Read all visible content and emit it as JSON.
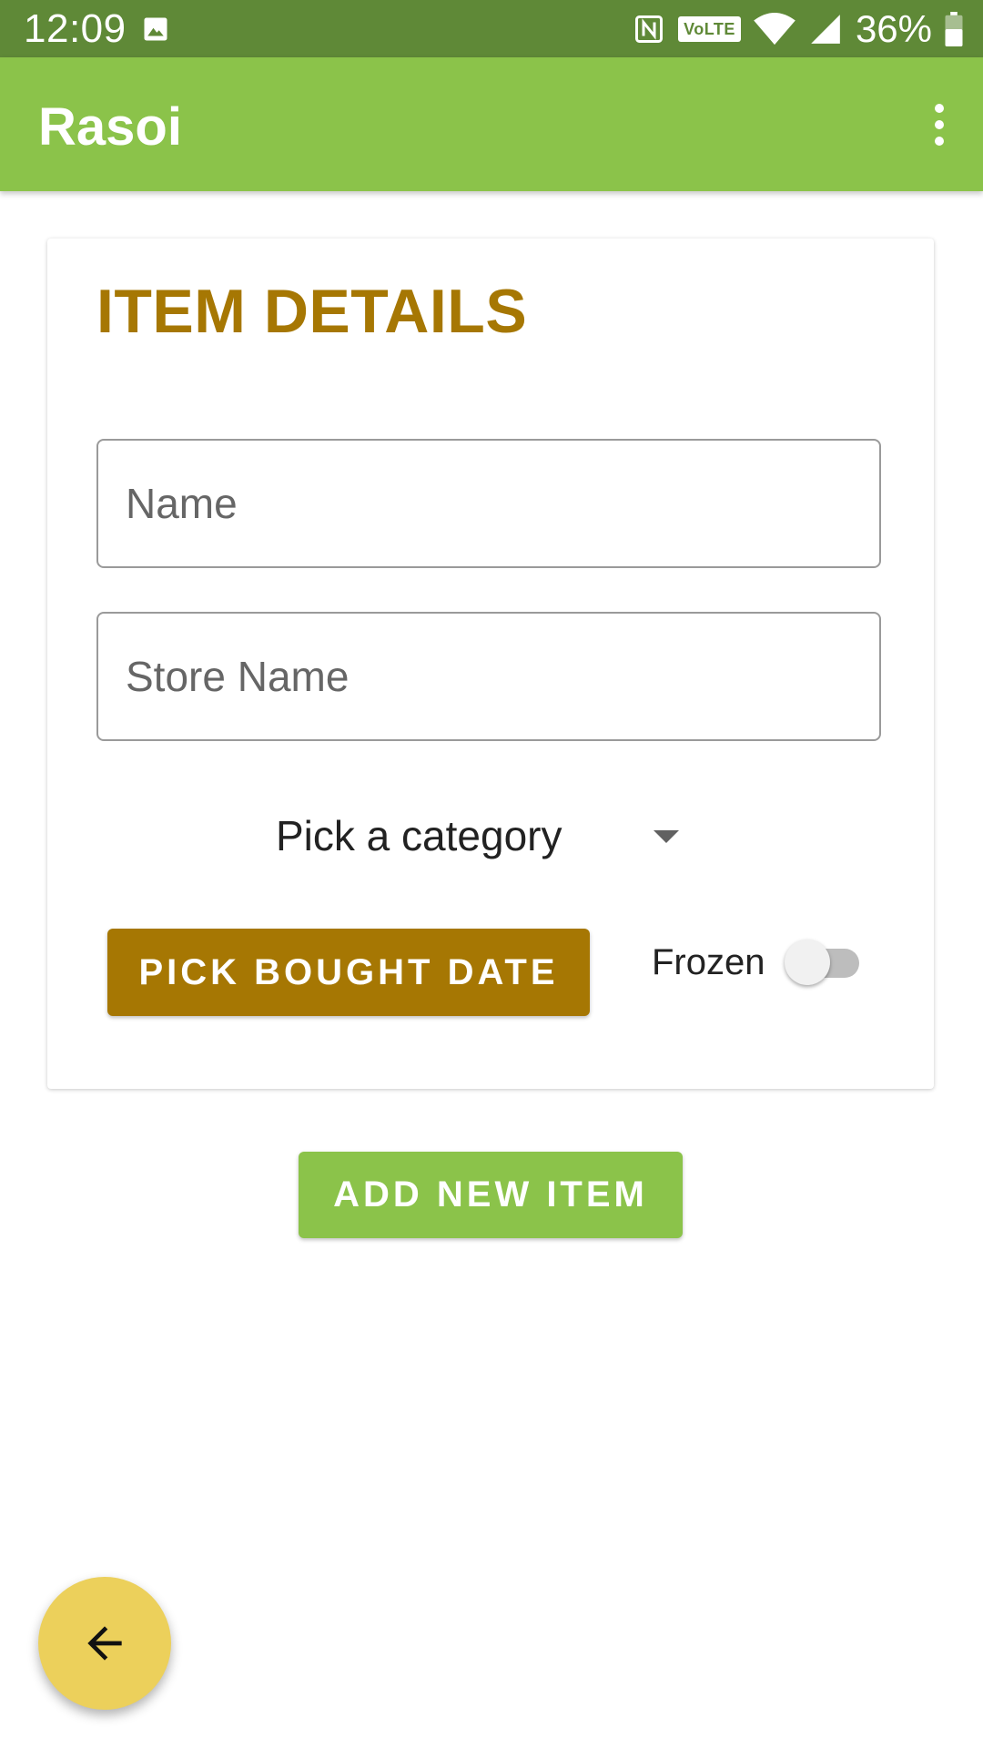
{
  "status_bar": {
    "time": "12:09",
    "left_icons": [
      "image-icon"
    ],
    "right_icons": [
      "nfc-icon",
      "volte-icon",
      "wifi-icon",
      "signal-icon",
      "battery-icon"
    ],
    "volte_label": "VoLTE",
    "battery_percent": "36%",
    "background_color": "#5f8937"
  },
  "app_bar": {
    "title": "Rasoi",
    "menu_icon": "overflow-menu-icon",
    "background_color": "#8bc34a"
  },
  "card": {
    "title": "ITEM DETAILS",
    "title_color": "#a67703",
    "name_field": {
      "placeholder": "Name",
      "value": ""
    },
    "store_field": {
      "placeholder": "Store Name",
      "value": ""
    },
    "category_spinner": {
      "selected": "Pick a category",
      "icon": "dropdown-arrow-icon"
    },
    "date_button": {
      "label": "PICK BOUGHT DATE",
      "color": "#a67703"
    },
    "frozen": {
      "label": "Frozen",
      "on": false
    }
  },
  "add_button": {
    "label": "ADD NEW ITEM",
    "color": "#8bc34a"
  },
  "fab": {
    "icon": "arrow-back-icon",
    "color": "#ecd05b"
  }
}
